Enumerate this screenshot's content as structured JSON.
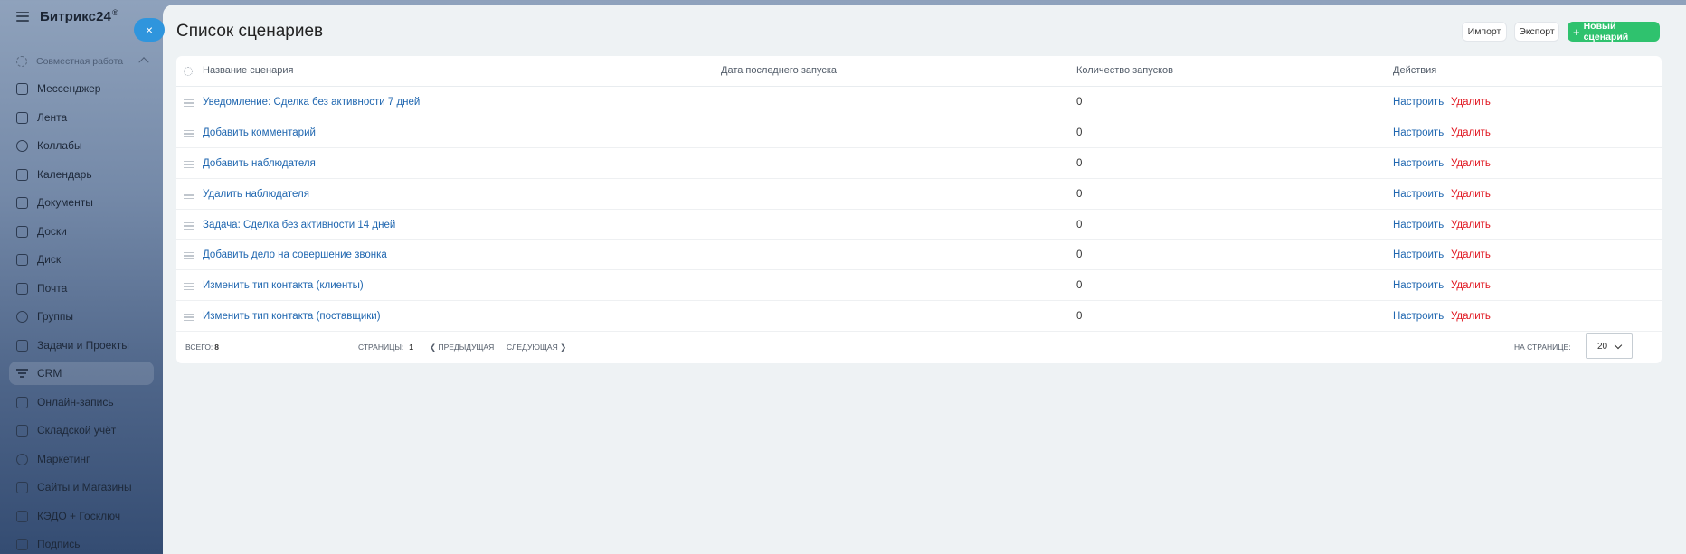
{
  "sidebar": {
    "logo": "Битрикс24",
    "logo_sup": "®",
    "group_title": "Совместная работа",
    "items": [
      {
        "label": "Мессенджер"
      },
      {
        "label": "Лента"
      },
      {
        "label": "Коллабы"
      },
      {
        "label": "Календарь"
      },
      {
        "label": "Документы"
      },
      {
        "label": "Доски"
      },
      {
        "label": "Диск"
      },
      {
        "label": "Почта"
      },
      {
        "label": "Группы"
      },
      {
        "label": "Задачи и Проекты"
      },
      {
        "label": "CRM"
      },
      {
        "label": "Онлайн-запись"
      },
      {
        "label": "Складской учёт"
      },
      {
        "label": "Маркетинг"
      },
      {
        "label": "Сайты и Магазины"
      },
      {
        "label": "КЭДО + Госключ"
      },
      {
        "label": "Подпись"
      }
    ]
  },
  "close_icon": "×",
  "page": {
    "title": "Список сценариев",
    "import_label": "Импорт",
    "export_label": "Экспорт",
    "new_label": "Новый сценарий",
    "new_icon": "+"
  },
  "table": {
    "columns": [
      "Название сценария",
      "Дата последнего запуска",
      "Количество запусков",
      "Действия"
    ],
    "setup_label": "Настроить",
    "delete_label": "Удалить",
    "rows": [
      {
        "name": "Уведомление: Сделка без активности 7 дней",
        "count": "0"
      },
      {
        "name": "Добавить комментарий",
        "count": "0"
      },
      {
        "name": "Добавить наблюдателя",
        "count": "0"
      },
      {
        "name": "Удалить наблюдателя",
        "count": "0"
      },
      {
        "name": "Задача: Сделка без активности 14 дней",
        "count": "0"
      },
      {
        "name": "Добавить дело на совершение звонка",
        "count": "0"
      },
      {
        "name": "Изменить тип контакта (клиенты)",
        "count": "0"
      },
      {
        "name": "Изменить тип контакта (поставщики)",
        "count": "0"
      }
    ]
  },
  "footer": {
    "total_label": "Всего:",
    "total_value": "8",
    "pages_label": "Страницы:",
    "pages_value": "1",
    "prev_label": "❮ Предыдущая",
    "next_label": "Следующая ❯",
    "perpage_label": "На странице:",
    "perpage_value": "20"
  }
}
